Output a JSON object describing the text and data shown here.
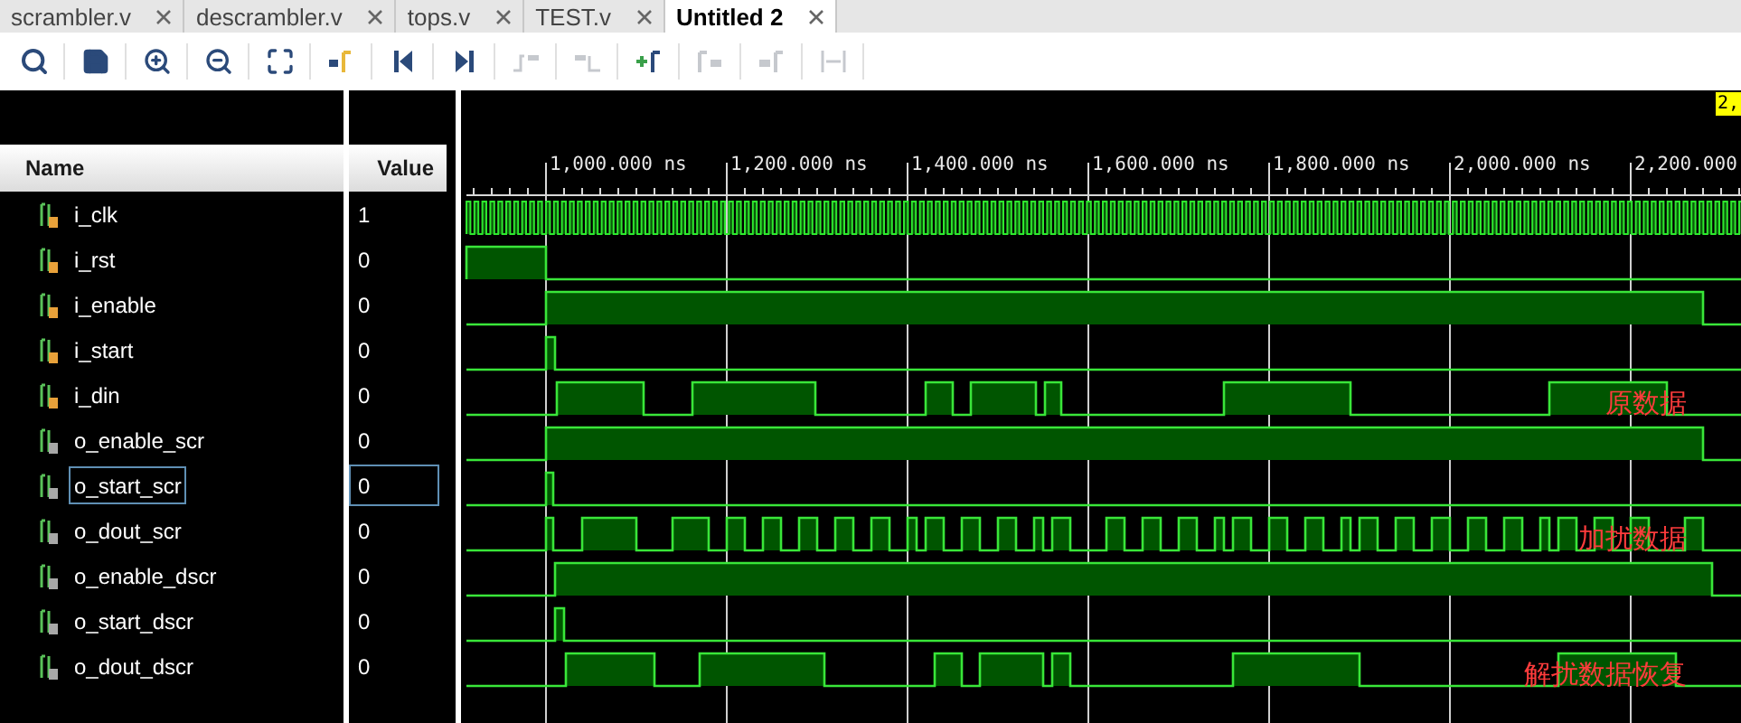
{
  "tabs": [
    {
      "label": "scrambler.v",
      "selected": false
    },
    {
      "label": "descrambler.v",
      "selected": false
    },
    {
      "label": "tops.v",
      "selected": false
    },
    {
      "label": "TEST.v",
      "selected": false
    },
    {
      "label": "Untitled 2",
      "selected": true
    }
  ],
  "toolbar": [
    {
      "disabled": false
    },
    {
      "disabled": false
    },
    {
      "disabled": false
    },
    {
      "disabled": false
    },
    {
      "disabled": false
    },
    {
      "disabled": false
    },
    {
      "disabled": false
    },
    {
      "disabled": false
    },
    {
      "disabled": true
    },
    {
      "disabled": true
    },
    {
      "disabled": false
    },
    {
      "disabled": true
    },
    {
      "disabled": true
    },
    {
      "disabled": true
    }
  ],
  "columns": {
    "name": "Name",
    "value": "Value"
  },
  "cursor_label": "2,",
  "ruler": {
    "labels": [
      "1,000.000 ns",
      "1,200.000 ns",
      "1,400.000 ns",
      "1,600.000 ns",
      "1,800.000 ns",
      "2,000.000 ns",
      "2,200.000"
    ]
  },
  "signals": [
    {
      "name": "i_clk",
      "value": "1",
      "kind": "input",
      "selected": false
    },
    {
      "name": "i_rst",
      "value": "0",
      "kind": "input",
      "selected": false
    },
    {
      "name": "i_enable",
      "value": "0",
      "kind": "input",
      "selected": false
    },
    {
      "name": "i_start",
      "value": "0",
      "kind": "input",
      "selected": false
    },
    {
      "name": "i_din",
      "value": "0",
      "kind": "input",
      "selected": false,
      "annotation": "原数据"
    },
    {
      "name": "o_enable_scr",
      "value": "0",
      "kind": "output",
      "selected": false
    },
    {
      "name": "o_start_scr",
      "value": "0",
      "kind": "output",
      "selected": true
    },
    {
      "name": "o_dout_scr",
      "value": "0",
      "kind": "output",
      "selected": false,
      "annotation": "加扰数据"
    },
    {
      "name": "o_enable_dscr",
      "value": "0",
      "kind": "output",
      "selected": false
    },
    {
      "name": "o_start_dscr",
      "value": "0",
      "kind": "output",
      "selected": false
    },
    {
      "name": "o_dout_dscr",
      "value": "0",
      "kind": "output",
      "selected": false,
      "annotation": "解扰数据恢复"
    }
  ]
}
